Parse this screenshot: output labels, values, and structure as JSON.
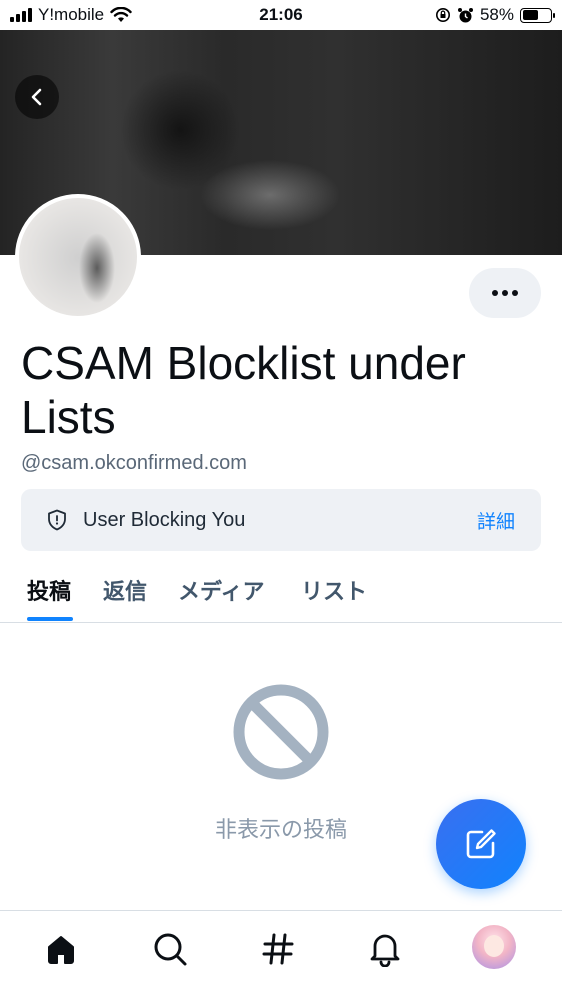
{
  "status_bar": {
    "carrier": "Y!mobile",
    "time": "21:06",
    "battery_percent": "58%",
    "battery_level": 0.58,
    "icons": [
      "signal-icon",
      "wifi-icon",
      "rotation-lock-icon",
      "alarm-icon",
      "battery-icon"
    ]
  },
  "profile": {
    "display_name": "CSAM Blocklist under Lists",
    "handle": "@csam.okconfirmed.com",
    "label": {
      "text": "User Blocking You",
      "link": "詳細",
      "icon": "shield-icon"
    }
  },
  "tabs": [
    {
      "label": "投稿",
      "active": true
    },
    {
      "label": "返信",
      "active": false
    },
    {
      "label": "メディア",
      "active": false
    },
    {
      "label": "リスト",
      "active": false
    }
  ],
  "empty_state": {
    "icon": "no-entry-icon",
    "text": "非表示の投稿"
  },
  "bottom_nav": [
    "home-icon",
    "search-icon",
    "feeds-icon",
    "notifications-icon",
    "profile-avatar"
  ],
  "colors": {
    "accent": "#1083fe",
    "muted": "#8a99aa",
    "label_bg": "#eef1f5"
  }
}
